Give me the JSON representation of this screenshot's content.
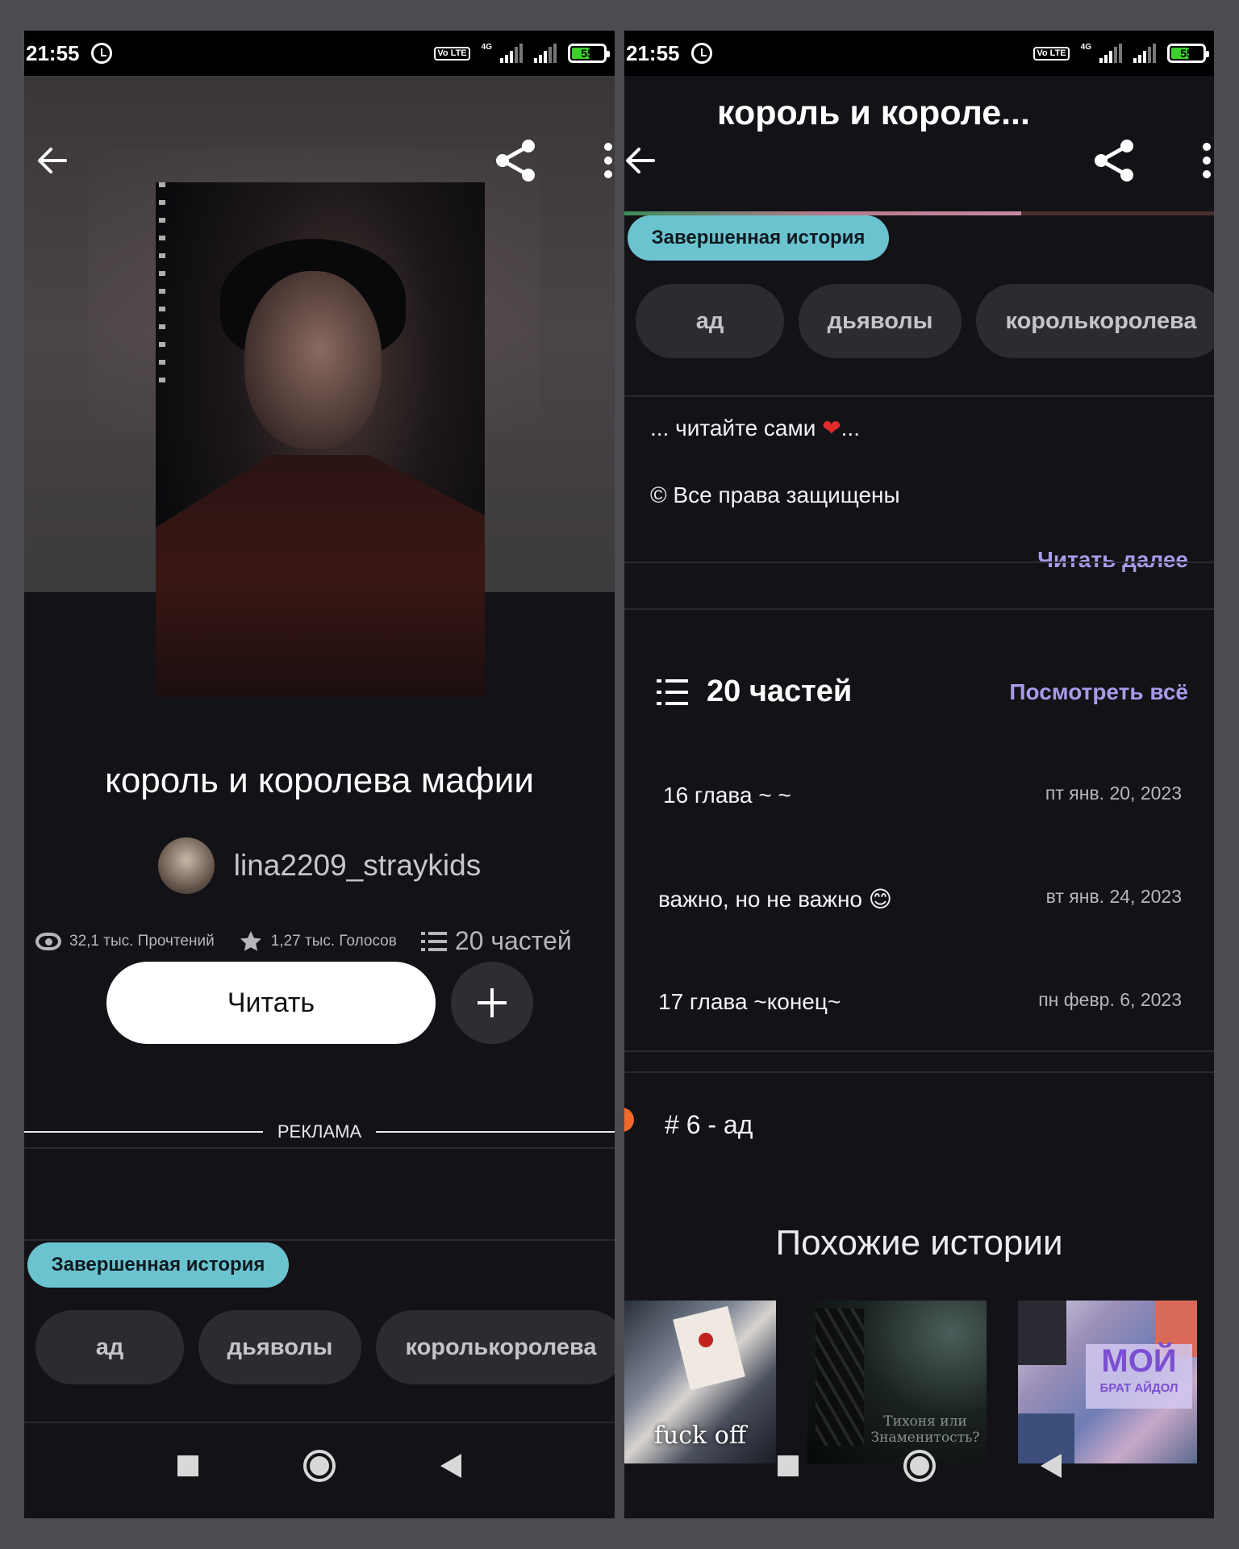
{
  "status": {
    "time": "21:55",
    "volte": "Vo LTE",
    "network": "4G",
    "battery": "55"
  },
  "left": {
    "title": "король и королева мафии",
    "author": "lina2209_straykids",
    "stats": {
      "reads": "32,1 тыс. Прочтений",
      "votes": "1,27 тыс. Голосов",
      "parts": "20 частей"
    },
    "read_button": "Читать",
    "ad_label": "РЕКЛАМА",
    "badge": "Завершенная история",
    "tags": [
      "ад",
      "дьяволы",
      "королькоролева"
    ]
  },
  "right": {
    "header_title": "король и короле...",
    "badge": "Завершенная история",
    "tags": [
      "ад",
      "дьяволы",
      "королькоролева"
    ],
    "description_line1": "... читайте сами ",
    "description_line1_end": "...",
    "description_line2": "© Все права защищены",
    "read_more": "Читать далее",
    "parts_count": "20 частей",
    "view_all": "Посмотреть всё",
    "chapters": [
      {
        "title": "16 глава ~ ~",
        "date": "пт янв. 20, 2023"
      },
      {
        "title": "важно, но не важно 😊",
        "date": "вт янв. 24, 2023"
      },
      {
        "title": "17 глава ~конец~",
        "date": "пн февр. 6, 2023"
      }
    ],
    "rank": "# 6 - ад",
    "similar_title": "Похожие истории",
    "similar": [
      {
        "overlay": "fuck off"
      },
      {
        "overlay": "Тихоня или Знаменитость?"
      },
      {
        "overlay_big": "МОЙ",
        "overlay_small": "БРАТ АЙДОЛ"
      }
    ]
  }
}
